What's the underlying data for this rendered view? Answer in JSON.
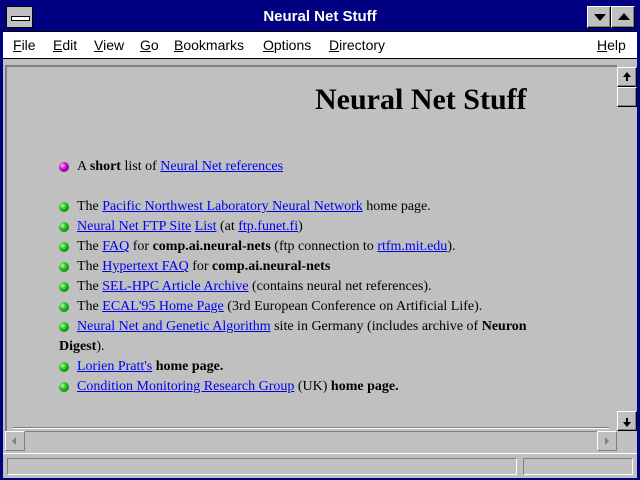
{
  "window": {
    "title": "Neural Net Stuff"
  },
  "menu": [
    "File",
    "Edit",
    "View",
    "Go",
    "Bookmarks",
    "Options",
    "Directory",
    "Help"
  ],
  "page": {
    "heading": "Neural Net Stuff",
    "intro": {
      "pre": "A ",
      "bold": "short",
      "mid": " list of ",
      "link": "Neural Net references"
    },
    "items": [
      {
        "pre": "The ",
        "link": "Pacific Northwest Laboratory Neural Network",
        "post": " home page."
      },
      {
        "link": "Neural Net FTP Site",
        "link2": "List",
        "mid": " (at ",
        "link3": "ftp.funet.fi",
        "post": ")"
      },
      {
        "pre": "The ",
        "link": "FAQ",
        "mid": " for ",
        "bold": "comp.ai.neural-nets",
        "mid2": " (ftp connection to ",
        "link2": "rtfm.mit.edu",
        "post": ")."
      },
      {
        "pre": "The ",
        "link": "Hypertext FAQ",
        "mid": " for ",
        "bold": "comp.ai.neural-nets"
      },
      {
        "pre": "The ",
        "link": "SEL-HPC Article Archive",
        "post": " (contains neural net references)."
      },
      {
        "pre": "The ",
        "link": "ECAL'95 Home Page",
        "post": " (3rd European Conference on Artificial Life)."
      },
      {
        "link": "Neural Net and Genetic Algorithm",
        "mid": " site in Germany (includes archive of ",
        "bold": "Neuron",
        "line2_bold": "Digest",
        "line2_post": ")."
      },
      {
        "link": "Lorien Pratt's",
        "bold": " home page."
      },
      {
        "link": "Condition Monitoring Research Group",
        "mid": " (UK) ",
        "bold": "home page."
      }
    ]
  },
  "colors": {
    "titlebar": "#000080",
    "link": "#0000ee",
    "bullet_green": "#20c020",
    "bullet_pink": "#c000c0"
  },
  "icons": [
    "system-menu-icon",
    "minimize-icon",
    "maximize-icon",
    "scroll-up-icon",
    "scroll-down-icon",
    "scroll-left-icon",
    "scroll-right-icon",
    "green-ball-icon",
    "pink-ball-icon"
  ]
}
